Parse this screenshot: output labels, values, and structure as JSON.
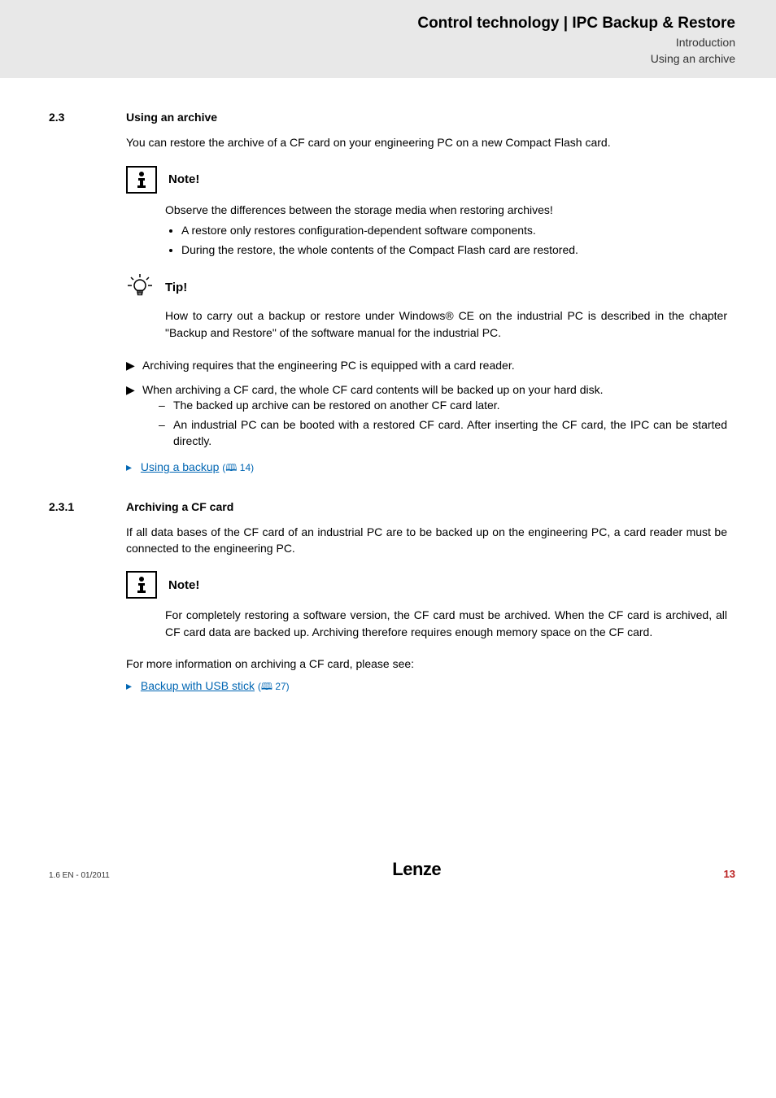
{
  "header": {
    "title": "Control technology | IPC Backup & Restore",
    "sub1": "Introduction",
    "sub2": "Using an archive"
  },
  "sec23": {
    "num": "2.3",
    "title": "Using an archive",
    "intro": "You can restore the archive of a CF card on your engineering PC on a new Compact Flash card."
  },
  "note1": {
    "label": "Note!",
    "lead": "Observe the differences between the storage media when restoring archives!",
    "b1": "A restore only restores configuration-dependent software components.",
    "b2": "During the restore, the whole contents of the Compact Flash card are restored."
  },
  "tip": {
    "label": "Tip!",
    "text": "How to carry out a backup or restore under Windows® CE on the industrial PC is described in the chapter \"Backup and Restore\" of the software manual for the industrial PC."
  },
  "tri": {
    "t1": "Archiving requires that the engineering PC is equipped with a card reader.",
    "t2": "When archiving a CF card, the whole CF card contents will be backed up on your hard disk.",
    "d1": "The backed up archive can be restored on another CF card later.",
    "d2": "An industrial PC can be booted with a restored CF card. After inserting the CF card, the IPC can be started directly."
  },
  "link1": {
    "text": "Using a backup",
    "ref": "(🕮 14)"
  },
  "sec231": {
    "num": "2.3.1",
    "title": "Archiving a CF card",
    "intro": "If all data bases of the CF card of an industrial PC are to be backed up on the engineering PC, a card reader must be connected to the engineering PC."
  },
  "note2": {
    "label": "Note!",
    "text": "For completely restoring a software version, the CF card must be archived. When the CF card is archived, all CF card data are backed up. Archiving therefore requires enough memory space on the CF card."
  },
  "more": {
    "lead": "For more information on archiving a CF card, please see:"
  },
  "link2": {
    "text": "Backup with USB stick",
    "ref": "(🕮 27)"
  },
  "footer": {
    "left": "1.6 EN - 01/2011",
    "center": "Lenze",
    "right": "13"
  }
}
